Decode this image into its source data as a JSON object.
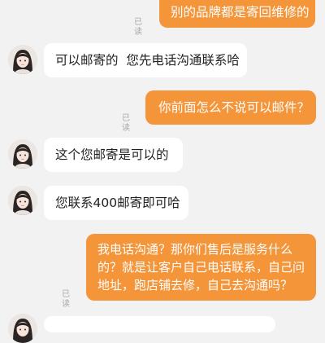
{
  "chat": {
    "messages": [
      {
        "direction": "out",
        "text": "别的品牌都是寄回维修的",
        "status": "已读"
      },
      {
        "direction": "in",
        "text": "可以邮寄的  您先电话沟通联系哈",
        "icon": "agent-avatar-icon"
      },
      {
        "direction": "out",
        "text": "你前面怎么不说可以邮件？",
        "status": "已读"
      },
      {
        "direction": "in",
        "text": "这个您邮寄是可以的",
        "icon": "agent-avatar-icon"
      },
      {
        "direction": "in",
        "text": "您联系400邮寄即可哈",
        "icon": "agent-avatar-icon"
      },
      {
        "direction": "out",
        "text": "我电话沟通？那你们售后是服务什么的？就是让客户自己电话联系，自己问地址，跑店铺去修，自己去沟通吗？",
        "status": "已读"
      },
      {
        "direction": "in",
        "text": "",
        "icon": "agent-avatar-icon"
      }
    ]
  },
  "colors": {
    "background": "#f2f2f2",
    "outgoing_bubble": "#f5953a",
    "incoming_bubble": "#ffffff",
    "read_receipt": "#a8a8a8"
  }
}
